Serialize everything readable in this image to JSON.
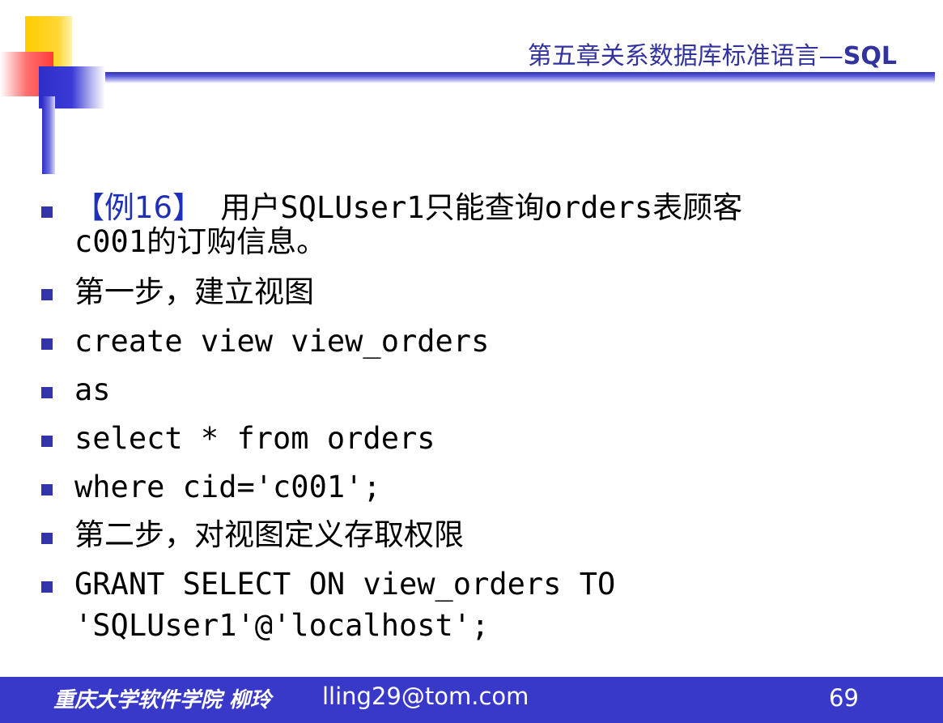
{
  "header": {
    "title_cn": "第五章关系数据库标准语言—",
    "title_sql": "SQL"
  },
  "bullets": [
    {
      "prefix": "【例16】",
      "line1": "  用户SQLUser1只能查询orders表顾客",
      "line2": "c001的订购信息。"
    },
    {
      "text": "第一步，建立视图"
    },
    {
      "text": "create view view_orders"
    },
    {
      "text": "as"
    },
    {
      "text": "select * from orders"
    },
    {
      "text": "where cid='c001';"
    },
    {
      "text": "第二步，对视图定义存取权限"
    },
    {
      "line1": "GRANT SELECT ON view_orders TO",
      "line2": "'SQLUser1'@'localhost';"
    }
  ],
  "footer": {
    "author": "重庆大学软件学院 柳玲",
    "email": "lling29@tom.com",
    "page": "69"
  },
  "colors": {
    "accent": "#3939c9",
    "header_text": "#3333a0",
    "example_label": "#1f2fb8"
  }
}
